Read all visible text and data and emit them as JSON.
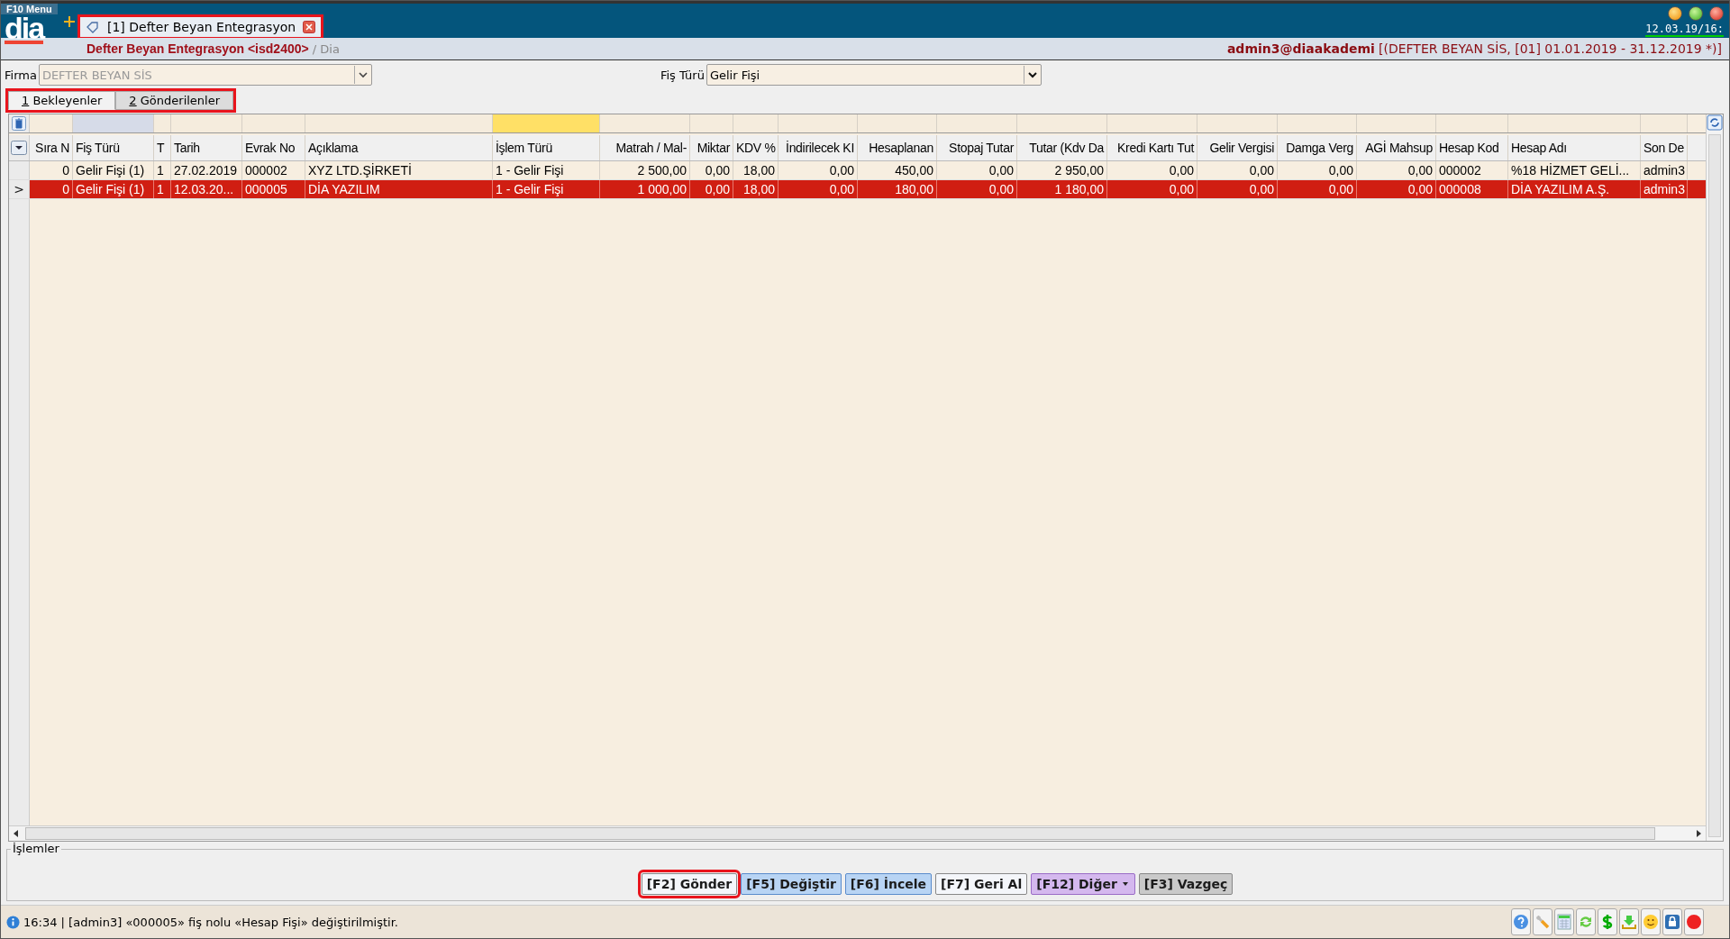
{
  "menu_label": "F10 Menu",
  "logo": "dia",
  "doc_tab": {
    "label": "[1] Defter Beyan Entegrasyon",
    "highlighted": true
  },
  "clock": "12.03.19/16:",
  "breadcrumb": {
    "title": "Defter Beyan Entegrasyon <isd2400>",
    "path": "/ Dia"
  },
  "user": {
    "name": "admin3@diaakademi",
    "context": "[(DEFTER BEYAN SİS, [01] 01.01.2019 - 31.12.2019 *)]"
  },
  "firma": {
    "label": "Firma",
    "value": "DEFTER BEYAN SİS",
    "disabled": true
  },
  "fis_turu": {
    "label": "Fiş Türü",
    "value": "Gelir Fişi"
  },
  "tabs": [
    {
      "key": "1",
      "label": " Bekleyenler",
      "selected": true
    },
    {
      "key": "2",
      "label": " Gönderilenler",
      "selected": false
    }
  ],
  "tabs_highlighted": true,
  "table": {
    "columns": [
      {
        "label": "Sıra N",
        "sorted": false,
        "filtered": false
      },
      {
        "label": "Fiş Türü",
        "sorted": true,
        "filtered": false
      },
      {
        "label": "T",
        "sorted": false,
        "filtered": false
      },
      {
        "label": "Tarih",
        "sorted": false,
        "filtered": false
      },
      {
        "label": "Evrak No",
        "sorted": false,
        "filtered": false
      },
      {
        "label": "Açıklama",
        "sorted": false,
        "filtered": false
      },
      {
        "label": "İşlem Türü",
        "sorted": false,
        "filtered": true
      },
      {
        "label": "Matrah / Mal-",
        "sorted": false,
        "filtered": false
      },
      {
        "label": "Miktar",
        "sorted": false,
        "filtered": false
      },
      {
        "label": "KDV %",
        "sorted": false,
        "filtered": false
      },
      {
        "label": "İndirilecek KI",
        "sorted": false,
        "filtered": false
      },
      {
        "label": "Hesaplanan",
        "sorted": false,
        "filtered": false
      },
      {
        "label": "Stopaj Tutar",
        "sorted": false,
        "filtered": false
      },
      {
        "label": "Tutar (Kdv Da",
        "sorted": false,
        "filtered": false
      },
      {
        "label": "Kredi Kartı Tut",
        "sorted": false,
        "filtered": false
      },
      {
        "label": "Gelir Vergisi",
        "sorted": false,
        "filtered": false
      },
      {
        "label": "Damga Verg",
        "sorted": false,
        "filtered": false
      },
      {
        "label": "AGİ Mahsup",
        "sorted": false,
        "filtered": false
      },
      {
        "label": "Hesap Kod",
        "sorted": false,
        "filtered": false
      },
      {
        "label": "Hesap Adı",
        "sorted": false,
        "filtered": false
      },
      {
        "label": "Son De",
        "sorted": false,
        "filtered": false
      }
    ],
    "rows": [
      {
        "selected": false,
        "cells": [
          "0",
          "Gelir Fişi (1)",
          "1",
          "27.02.2019",
          "000002",
          "XYZ LTD.ŞİRKETİ",
          "1 - Gelir Fişi",
          "2 500,00",
          "0,00",
          "18,00",
          "0,00",
          "450,00",
          "0,00",
          "2 950,00",
          "0,00",
          "0,00",
          "0,00",
          "0,00",
          "000002",
          "%18 HİZMET GELİ...",
          "admin3"
        ]
      },
      {
        "selected": true,
        "cells": [
          "0",
          "Gelir Fişi (1)",
          "1",
          "12.03.20...",
          "000005",
          "DİA YAZILIM",
          "1 - Gelir Fişi",
          "1 000,00",
          "0,00",
          "18,00",
          "0,00",
          "180,00",
          "0,00",
          "1 180,00",
          "0,00",
          "0,00",
          "0,00",
          "0,00",
          "000008",
          "DİA YAZILIM A.Ş.",
          "admin3"
        ]
      }
    ],
    "current_marker": ">"
  },
  "actions": {
    "title": "İşlemler",
    "buttons": [
      {
        "label": "[F2] Gönder",
        "kind": "plain",
        "highlighted": true
      },
      {
        "label": "[F5] Değiştir",
        "kind": "blue",
        "highlighted": false
      },
      {
        "label": "[F6] İncele",
        "kind": "blue",
        "highlighted": false
      },
      {
        "label": "[F7] Geri Al",
        "kind": "plain",
        "highlighted": false
      },
      {
        "label": "[F12] Diğer",
        "kind": "purple",
        "highlighted": false,
        "dropdown": true
      },
      {
        "label": "[F3] Vazgeç",
        "kind": "grey",
        "highlighted": false
      }
    ]
  },
  "status": {
    "message": "16:34 | [admin3] «000005» fiş nolu «Hesap Fişi» değiştirilmiştir."
  },
  "tray": [
    {
      "kind": "help"
    },
    {
      "kind": "wrench"
    },
    {
      "kind": "calculator"
    },
    {
      "kind": "sync"
    },
    {
      "kind": "dollar"
    },
    {
      "kind": "download"
    },
    {
      "kind": "smiley"
    },
    {
      "kind": "lock"
    },
    {
      "kind": "stop"
    }
  ]
}
